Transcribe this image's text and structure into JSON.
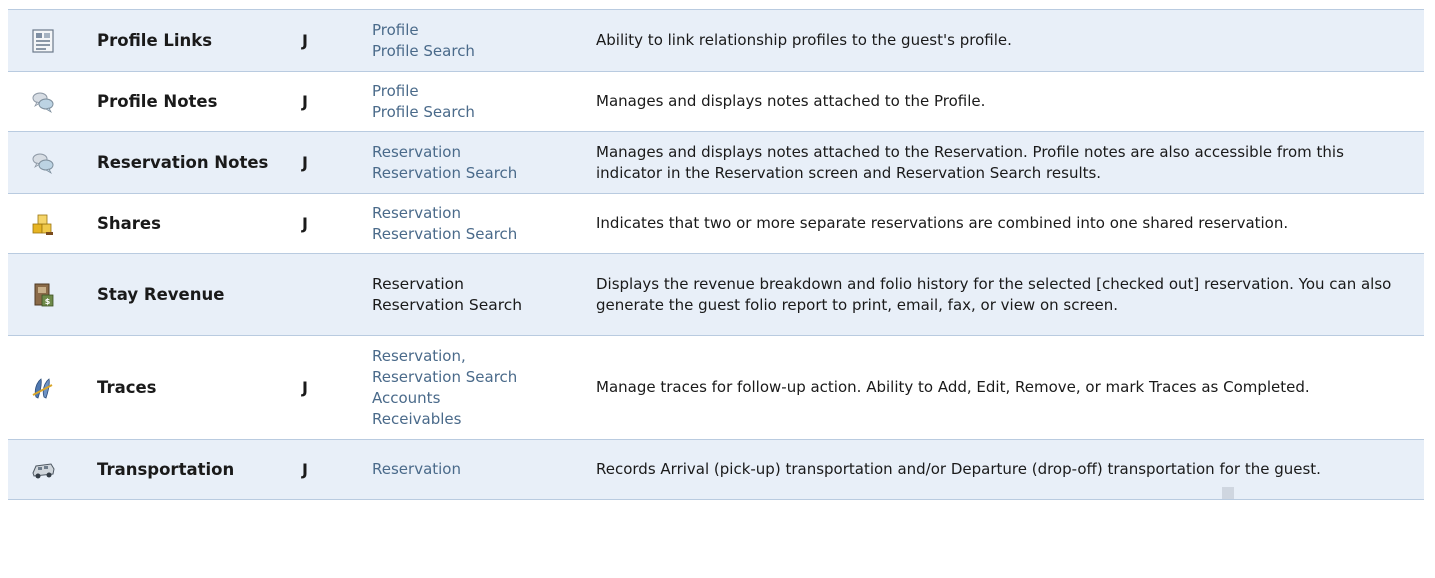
{
  "rows": [
    {
      "icon": "profile-links-icon",
      "name": "Profile Links",
      "flag": "J",
      "locations": [
        "Profile",
        "Profile Search"
      ],
      "description": "Ability to link relationship profiles to the guest's profile."
    },
    {
      "icon": "notes-icon",
      "name": "Profile Notes",
      "flag": "J",
      "locations": [
        "Profile",
        "Profile Search"
      ],
      "description": "Manages and displays notes attached to the Profile."
    },
    {
      "icon": "notes-icon",
      "name": "Reservation Notes",
      "flag": "J",
      "locations": [
        "Reservation",
        "Reservation Search"
      ],
      "description": "Manages and displays notes attached to the Reservation. Profile notes are also accessible from this indicator in the Reservation screen and Reservation Search results."
    },
    {
      "icon": "shares-icon",
      "name": "Shares",
      "flag": "J",
      "locations": [
        "Reservation",
        "Reservation Search"
      ],
      "description": "Indicates that two or more separate reservations are combined into one shared reservation."
    },
    {
      "icon": "stay-revenue-icon",
      "name": "Stay Revenue",
      "flag": "",
      "locations": [
        "Reservation",
        "Reservation Search"
      ],
      "description": "Displays the revenue breakdown and folio history for the selected [checked out] reservation. You can also generate the guest folio report to print, email, fax, or view on screen."
    },
    {
      "icon": "traces-icon",
      "name": "Traces",
      "flag": "J",
      "locations": [
        "Reservation,",
        "Reservation Search",
        "Accounts",
        "Receivables"
      ],
      "description": "Manage traces for follow-up action. Ability to Add, Edit, Remove, or mark Traces as Completed."
    },
    {
      "icon": "transportation-icon",
      "name": "Transportation",
      "flag": "J",
      "locations": [
        "Reservation"
      ],
      "description": "Records Arrival (pick-up) transportation and/or Departure (drop-off) transportation for the guest."
    }
  ]
}
